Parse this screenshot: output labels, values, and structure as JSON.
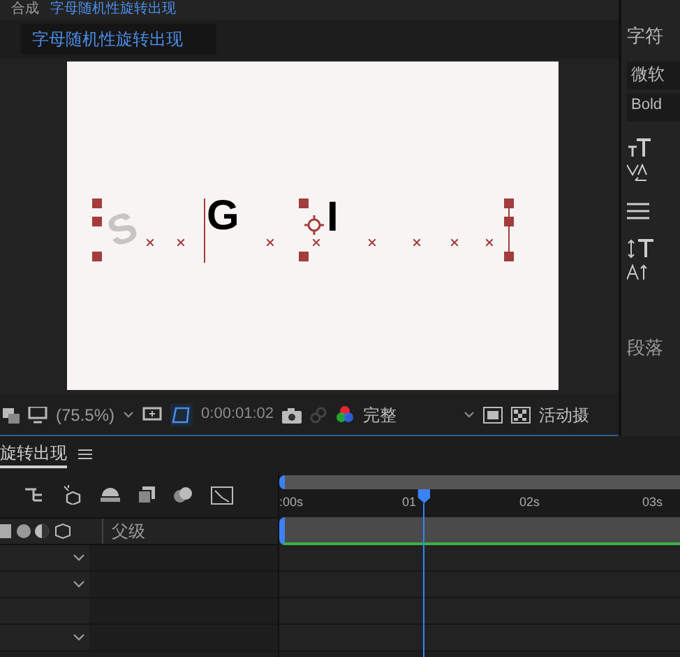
{
  "comp_panel": {
    "tab_prefix": "合成",
    "tab_title": "字母随机性旋转出现",
    "comp_name": "字母随机性旋转出现"
  },
  "canvas": {
    "letters": [
      {
        "char": "S",
        "faded": true
      },
      {
        "char": "G",
        "faded": false
      },
      {
        "char": "I",
        "faded": false
      }
    ]
  },
  "viewer_toolbar": {
    "zoom": "(75.5%)",
    "timecode": "0:00:01:02",
    "resolution": "完整",
    "camera": "活动摄"
  },
  "timeline": {
    "tab": "旋转出现",
    "ruler": [
      ":00s",
      "01",
      "02s",
      "03s"
    ],
    "column_header": "父级",
    "rows": [
      {
        "kind": "dropdown"
      },
      {
        "kind": "dropdown"
      },
      {
        "kind": "empty"
      },
      {
        "kind": "dropdown"
      }
    ]
  },
  "character_panel": {
    "title": "字符",
    "font": "微软",
    "style": "Bold",
    "paragraph": "段落"
  }
}
